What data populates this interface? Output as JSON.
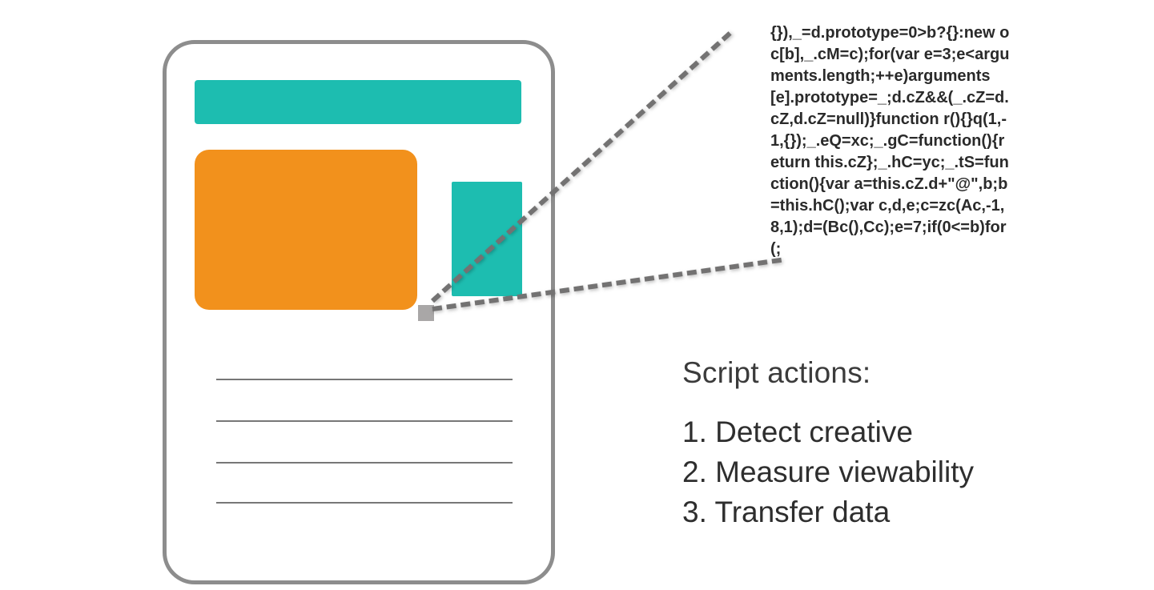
{
  "code_text": "{}),_=d.prototype=0>b?{}:new oc[b],_.cM=c);for(var e=3;e<arguments.length;++e)arguments[e].prototype=_;d.cZ&&(_.cZ=d.cZ,d.cZ=null)}function r(){}q(1,-1,{});_.eQ=xc;_.gC=function(){return this.cZ};_.hC=yc;_.tS=function(){var a=this.cZ.d+\"@\",b;b=this.hC();var c,d,e;c=zc(Ac,-1,8,1);d=(Bc(),Cc);e=7;if(0<=b)for(;",
  "actions": {
    "title": "Script actions:",
    "items": [
      "1. Detect creative",
      "2. Measure viewability",
      "3. Transfer data"
    ]
  },
  "colors": {
    "teal": "#1dbdb0",
    "orange": "#f2911c",
    "grey": "#8d8d8d"
  }
}
